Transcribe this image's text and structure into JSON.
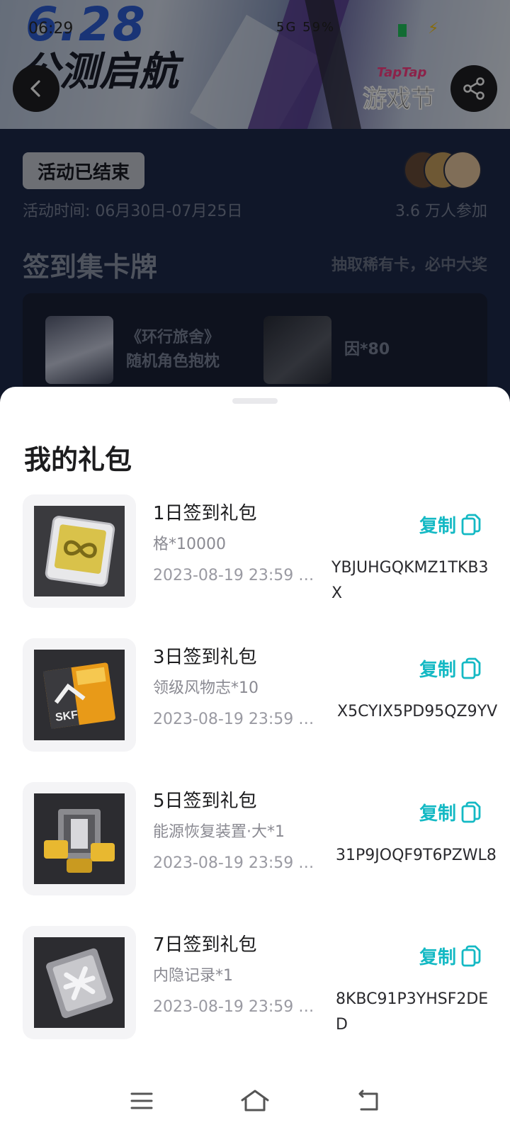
{
  "status_bar": {
    "time": "06:29",
    "right_text": "5G 59%"
  },
  "banner": {
    "date": "6.28",
    "subtitle": "公测启航",
    "logo_top": "TapTap",
    "logo_bottom": "游戏节"
  },
  "activity": {
    "status_badge": "活动已结束",
    "time_range": "活动时间: 06月30日-07月25日",
    "participants": "3.6 万人参加",
    "section_title": "签到集卡牌",
    "section_subtitle": "抽取稀有卡，必中大奖",
    "rewards": [
      {
        "line1": "《环行旅舍》",
        "line2": "随机角色抱枕"
      },
      {
        "line1": "因*80",
        "line2": ""
      }
    ]
  },
  "sheet": {
    "title": "我的礼包",
    "copy_label": "复制",
    "gifts": [
      {
        "name": "1日签到礼包",
        "content": "格*10000",
        "expire": "2023-08-19 23:59 …",
        "code": "YBJUHGQKMZ1TKB3X",
        "icon": "infinity-card-icon",
        "accent": "#d9c24a"
      },
      {
        "name": "3日签到礼包",
        "content": "领级风物志*10",
        "expire": "2023-08-19 23:59 …",
        "code": "X5CYIX5PD95QZ9YV",
        "icon": "magazine-icon",
        "accent": "#f0a020"
      },
      {
        "name": "5日签到礼包",
        "content": "能源恢复装置·大*1",
        "expire": "2023-08-19 23:59 …",
        "code": "31P9JOQF9T6PZWL8",
        "icon": "energy-device-icon",
        "accent": "#e8b830"
      },
      {
        "name": "7日签到礼包",
        "content": "内隐记录*1",
        "expire": "2023-08-19 23:59 …",
        "code": "8KBC91P3YHSF2DED",
        "icon": "record-icon",
        "accent": "#d8d8dc"
      }
    ]
  },
  "colors": {
    "accent": "#14b9c4",
    "badge_bg": "#c6cad4"
  }
}
